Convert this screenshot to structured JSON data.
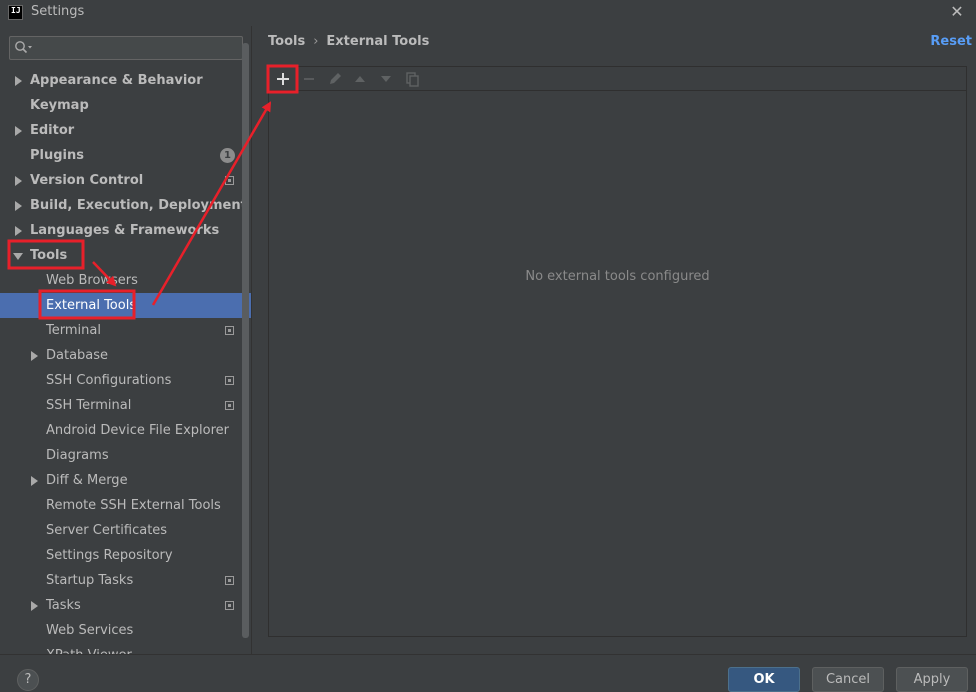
{
  "window": {
    "title": "Settings",
    "logo_text": "IJ",
    "close_glyph": "✕"
  },
  "search": {
    "placeholder": "",
    "value": ""
  },
  "sidebar": {
    "items": [
      {
        "label": "Appearance & Behavior",
        "level": 0,
        "bold": true,
        "expander": "collapsed"
      },
      {
        "label": "Keymap",
        "level": 0,
        "bold": true,
        "expander": "none"
      },
      {
        "label": "Editor",
        "level": 0,
        "bold": true,
        "expander": "collapsed"
      },
      {
        "label": "Plugins",
        "level": 0,
        "bold": true,
        "expander": "none",
        "badge": "1"
      },
      {
        "label": "Version Control",
        "level": 0,
        "bold": true,
        "expander": "collapsed",
        "project_icon": true
      },
      {
        "label": "Build, Execution, Deployment",
        "level": 0,
        "bold": true,
        "expander": "collapsed"
      },
      {
        "label": "Languages & Frameworks",
        "level": 0,
        "bold": true,
        "expander": "collapsed"
      },
      {
        "label": "Tools",
        "level": 0,
        "bold": true,
        "expander": "expanded"
      },
      {
        "label": "Web Browsers",
        "level": 1,
        "bold": false,
        "expander": "none"
      },
      {
        "label": "External Tools",
        "level": 1,
        "bold": false,
        "expander": "none",
        "selected": true
      },
      {
        "label": "Terminal",
        "level": 1,
        "bold": false,
        "expander": "none",
        "project_icon": true
      },
      {
        "label": "Database",
        "level": 1,
        "bold": false,
        "expander": "collapsed"
      },
      {
        "label": "SSH Configurations",
        "level": 1,
        "bold": false,
        "expander": "none",
        "project_icon": true
      },
      {
        "label": "SSH Terminal",
        "level": 1,
        "bold": false,
        "expander": "none",
        "project_icon": true
      },
      {
        "label": "Android Device File Explorer",
        "level": 1,
        "bold": false,
        "expander": "none"
      },
      {
        "label": "Diagrams",
        "level": 1,
        "bold": false,
        "expander": "none"
      },
      {
        "label": "Diff & Merge",
        "level": 1,
        "bold": false,
        "expander": "collapsed"
      },
      {
        "label": "Remote SSH External Tools",
        "level": 1,
        "bold": false,
        "expander": "none"
      },
      {
        "label": "Server Certificates",
        "level": 1,
        "bold": false,
        "expander": "none"
      },
      {
        "label": "Settings Repository",
        "level": 1,
        "bold": false,
        "expander": "none"
      },
      {
        "label": "Startup Tasks",
        "level": 1,
        "bold": false,
        "expander": "none",
        "project_icon": true
      },
      {
        "label": "Tasks",
        "level": 1,
        "bold": false,
        "expander": "collapsed",
        "project_icon": true
      },
      {
        "label": "Web Services",
        "level": 1,
        "bold": false,
        "expander": "none"
      },
      {
        "label": "XPath Viewer",
        "level": 1,
        "bold": false,
        "expander": "none"
      }
    ]
  },
  "main": {
    "breadcrumb": [
      "Tools",
      "External Tools"
    ],
    "breadcrumb_sep": "›",
    "reset_label": "Reset",
    "toolbar": {
      "add": "add-icon",
      "remove": "remove-icon",
      "edit": "edit-icon",
      "move_up": "move-up-icon",
      "move_down": "move-down-icon",
      "copy": "copy-icon"
    },
    "empty_text": "No external tools configured"
  },
  "footer": {
    "help_label": "?",
    "ok_label": "OK",
    "cancel_label": "Cancel",
    "apply_label": "Apply"
  },
  "colors": {
    "background": "#3c3f41",
    "selection": "#4b6eaf",
    "link": "#589df6",
    "primary_button": "#365880",
    "annotation": "#e8202a"
  }
}
